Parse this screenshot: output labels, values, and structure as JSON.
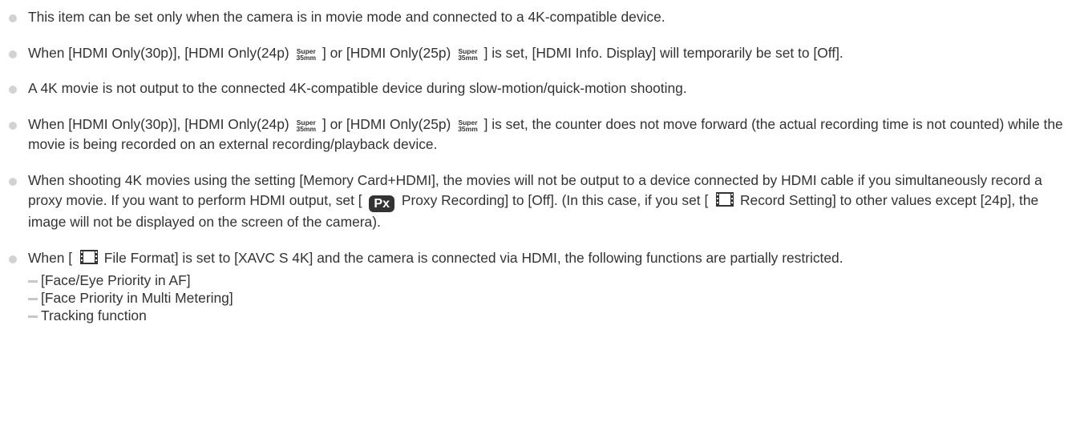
{
  "notes": [
    {
      "text": "This item can be set only when the camera is in movie mode and connected to a 4K-compatible device."
    },
    {
      "a": "When [HDMI Only(30p)], [HDMI Only(24p)",
      "b": "] or [HDMI Only(25p)",
      "c": "] is set, [HDMI Info. Display] will temporarily be set to [Off]."
    },
    {
      "text": "A 4K movie is not output to the connected 4K-compatible device during slow-motion/quick-motion shooting."
    },
    {
      "a": "When [HDMI Only(30p)], [HDMI Only(24p)",
      "b": "] or [HDMI Only(25p)",
      "c": "] is set, the counter does not move forward (the actual recording time is not counted) while the movie is being recorded on an external recording/playback device."
    },
    {
      "a": "When shooting 4K movies using the setting [Memory Card+HDMI], the movies will not be output to a device connected by HDMI cable if you simultaneously record a proxy movie. If you want to perform HDMI output, set [",
      "b": "Proxy Recording] to [Off]. (In this case, if you set [",
      "c": "Record Setting] to other values except [24p], the image will not be displayed on the screen of the camera)."
    },
    {
      "a": "When [",
      "b": "File Format] is set to [XAVC S 4K] and the camera is connected via HDMI, the following functions are partially restricted.",
      "subs": [
        "[Face/Eye Priority in AF]",
        "[Face Priority in Multi Metering]",
        "Tracking function"
      ]
    }
  ],
  "icons": {
    "super_top": "Super",
    "super_bottom": "35mm",
    "proxy": "Px",
    "movie": "film-icon"
  },
  "colors": {
    "text": "#333333",
    "bullet": "#d2d2d2",
    "dash": "#c7c7c7"
  }
}
